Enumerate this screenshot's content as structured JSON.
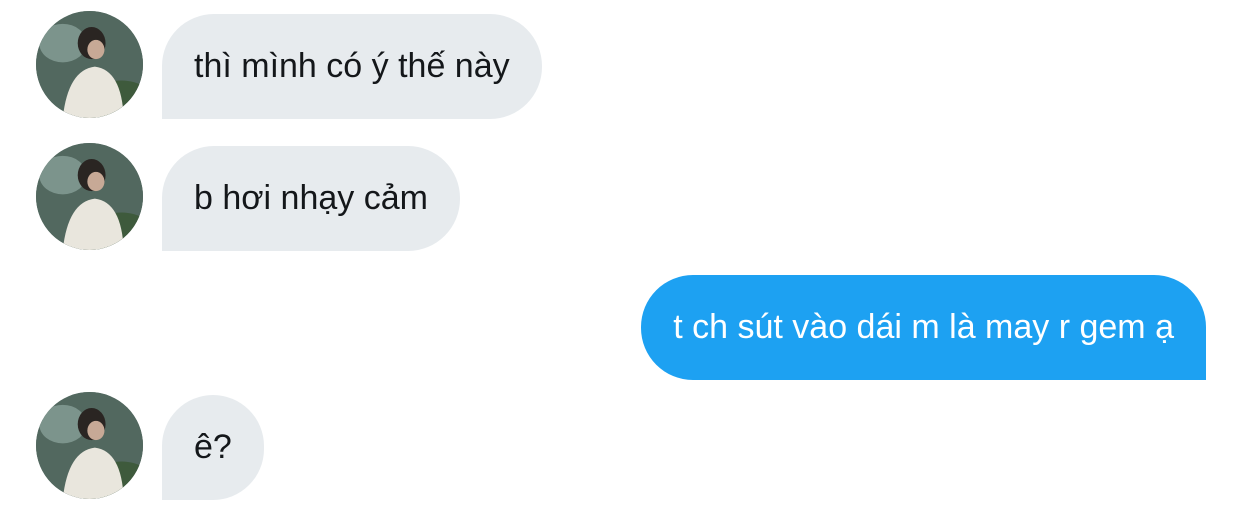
{
  "messages": [
    {
      "direction": "incoming",
      "text": "thì mình có ý thế này"
    },
    {
      "direction": "incoming",
      "text": "b hơi nhạy cảm"
    },
    {
      "direction": "outgoing",
      "text": "t ch sút vào dái m là may r gem ạ"
    },
    {
      "direction": "incoming",
      "text": "ê?"
    }
  ],
  "colors": {
    "incoming_bubble": "#e7ebee",
    "outgoing_bubble": "#1da1f2",
    "incoming_text": "#14171a",
    "outgoing_text": "#ffffff"
  },
  "icons": {
    "avatar": "contact-avatar-photo"
  }
}
